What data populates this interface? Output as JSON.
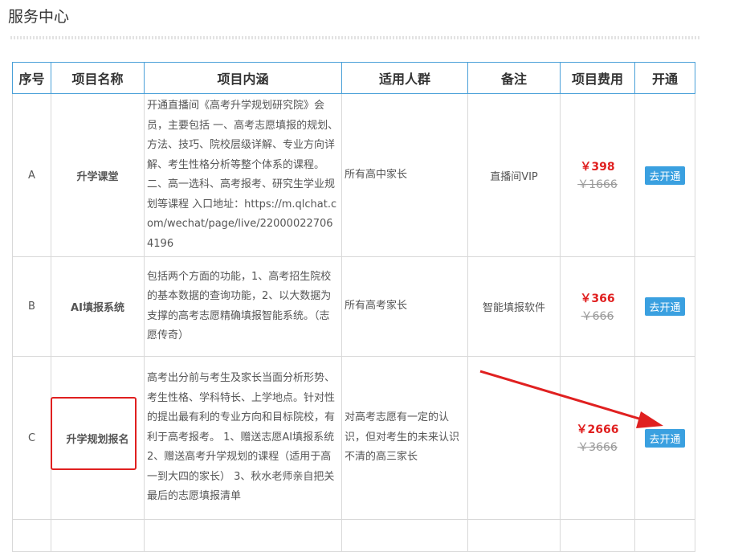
{
  "page": {
    "title": "服务中心"
  },
  "table": {
    "headers": [
      "序号",
      "项目名称",
      "项目内涵",
      "适用人群",
      "备注",
      "项目费用",
      "开通"
    ],
    "rows": [
      {
        "seq": "A",
        "name": "升学课堂",
        "desc": "开通直播间《高考升学规划研究院》会员，主要包括 一、高考志愿填报的规划、方法、技巧、院校层级详解、专业方向详解、考生性格分析等整个体系的课程。 二、高一选科、高考报考、研究生学业规划等课程 入口地址：https://m.qlchat.com/wechat/page/live/220000227064196",
        "audience": "所有高中家长",
        "note": "直播间VIP",
        "price_now": "￥398",
        "price_old": "￥1666",
        "open_label": "去开通"
      },
      {
        "seq": "B",
        "name": "AI填报系统",
        "desc": "包括两个方面的功能，1、高考招生院校的基本数据的查询功能，2、以大数据为支撑的高考志愿精确填报智能系统。（志愿传奇）",
        "audience": "所有高考家长",
        "note": "智能填报软件",
        "price_now": "￥366",
        "price_old": "￥666",
        "open_label": "去开通"
      },
      {
        "seq": "C",
        "name": "升学规划报名",
        "desc": "高考出分前与考生及家长当面分析形势、考生性格、学科特长、上学地点。针对性的提出最有利的专业方向和目标院校，有利于高考报考。 1、赠送志愿AI填报系统 2、赠送高考升学规划的课程（适用于高一到大四的家长） 3、秋水老师亲自把关最后的志愿填报清单",
        "audience": "对高考志愿有一定的认识，但对考生的未来认识不清的高三家长",
        "note": "",
        "price_now": "￥2666",
        "price_old": "￥3666",
        "open_label": "去开通"
      }
    ]
  },
  "annotation": {
    "color": "#e02020"
  }
}
